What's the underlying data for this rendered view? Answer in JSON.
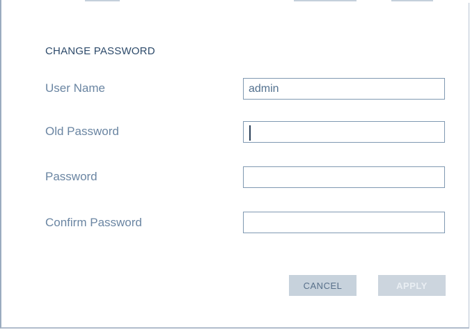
{
  "dialog": {
    "title": "CHANGE PASSWORD"
  },
  "fields": {
    "user_name": {
      "label": "User Name",
      "value": "admin"
    },
    "old_password": {
      "label": "Old Password",
      "value": ""
    },
    "password": {
      "label": "Password",
      "value": ""
    },
    "confirm_password": {
      "label": "Confirm Password",
      "value": ""
    }
  },
  "buttons": {
    "cancel_label": "CANCEL",
    "apply_label": "APPLY"
  },
  "colors": {
    "title": "#2d4a6a",
    "label": "#6a85a2",
    "input_border": "#7f98b1",
    "cancel_bg": "#c7d2dc",
    "apply_bg": "#ccd5de"
  }
}
